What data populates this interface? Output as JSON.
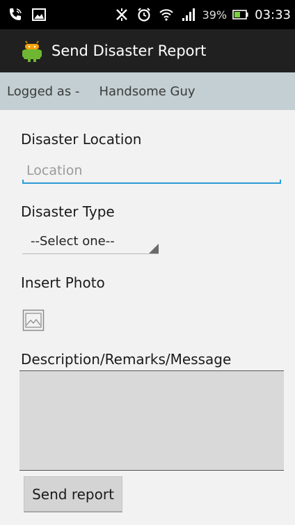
{
  "status_bar": {
    "battery_percent": "39%",
    "time": "03:33",
    "icons": [
      "phone-call-icon",
      "image-notification-icon",
      "vibrate-icon",
      "alarm-icon",
      "wifi-icon",
      "signal-icon",
      "battery-icon"
    ]
  },
  "action_bar": {
    "title": "Send Disaster Report",
    "icon": "android-app-icon"
  },
  "user_bar": {
    "label": "Logged as -",
    "username": "Handsome Guy"
  },
  "form": {
    "location_label": "Disaster Location",
    "location_placeholder": "Location",
    "location_value": "",
    "type_label": "Disaster Type",
    "type_selected": "--Select one--",
    "photo_label": "Insert Photo",
    "description_label": "Description/Remarks/Message",
    "description_value": "",
    "submit_label": "Send report"
  },
  "colors": {
    "accent": "#2a9ad5",
    "action_bar": "#202020",
    "user_bar": "#c3cfd2"
  }
}
